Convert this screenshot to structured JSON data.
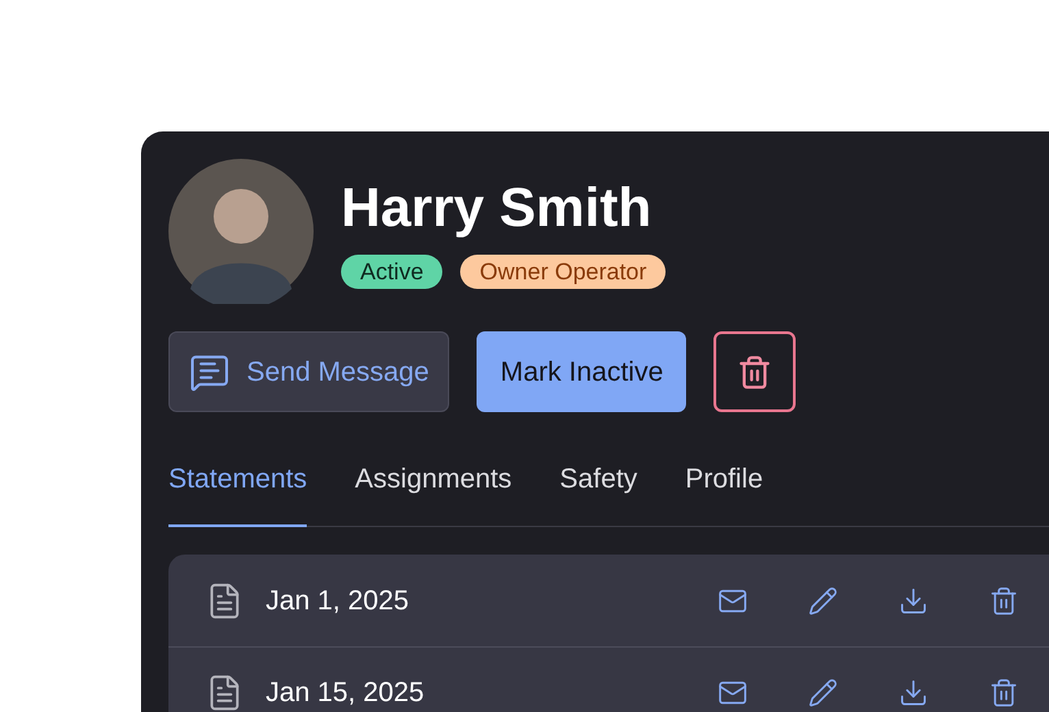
{
  "profile": {
    "name": "Harry Smith",
    "badges": [
      {
        "label": "Active",
        "color": "#5fd4a6"
      },
      {
        "label": "Owner Operator",
        "color": "#fdc99e"
      }
    ]
  },
  "actions": [
    {
      "kind": "message",
      "label": "Send Message"
    },
    {
      "kind": "primary",
      "label": "Mark Inactive"
    },
    {
      "kind": "delete"
    }
  ],
  "tabs": [
    {
      "label": "Statements",
      "selected": true
    },
    {
      "label": "Assignments",
      "selected": false
    },
    {
      "label": "Safety",
      "selected": false
    },
    {
      "label": "Profile",
      "selected": false
    }
  ],
  "statements": [
    {
      "date": "Jan 1, 2025"
    },
    {
      "date": "Jan 15, 2025"
    }
  ]
}
